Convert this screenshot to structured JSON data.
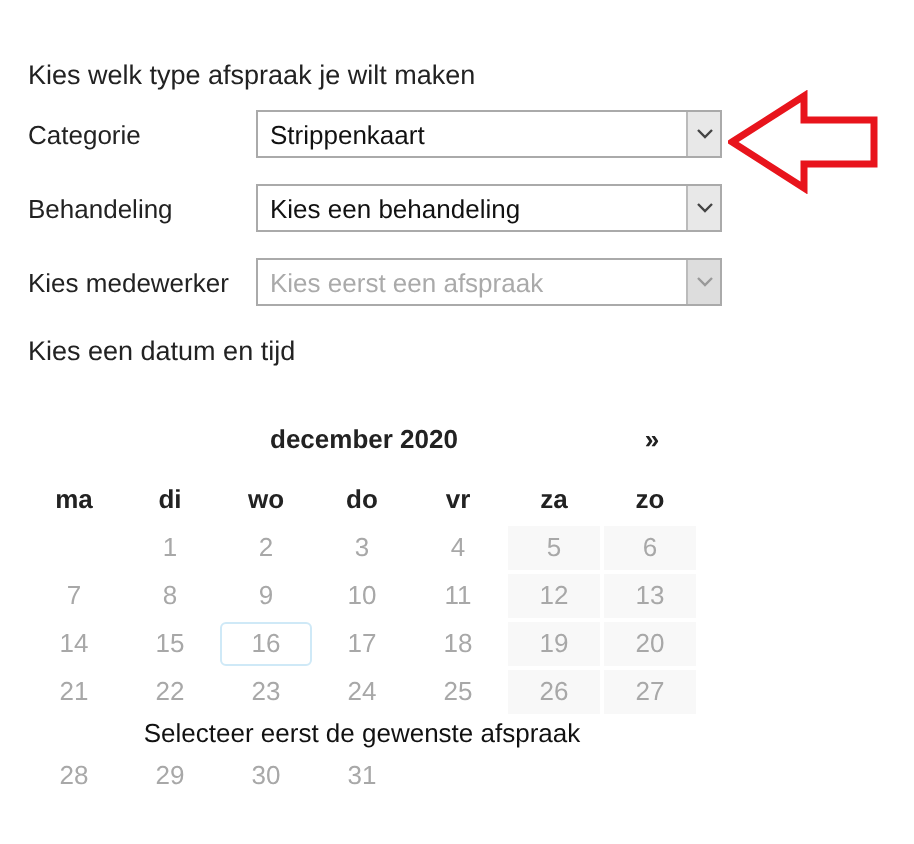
{
  "heading": "Kies welk type afspraak je wilt maken",
  "fields": [
    {
      "label": "Categorie",
      "value": "Strippenkaart",
      "disabled": false
    },
    {
      "label": "Behandeling",
      "value": "Kies een behandeling",
      "disabled": false
    },
    {
      "label": "Kies medewerker",
      "value": "Kies eerst een afspraak",
      "disabled": true
    }
  ],
  "date_heading": "Kies een datum en tijd",
  "calendar": {
    "month": "december 2020",
    "next": "»",
    "weekdays": [
      "ma",
      "di",
      "wo",
      "do",
      "vr",
      "za",
      "zo"
    ],
    "days": [
      {
        "kind": "empty"
      },
      {
        "text": "1",
        "kind": "weekday",
        "selected": false
      },
      {
        "text": "2",
        "kind": "weekday",
        "selected": false
      },
      {
        "text": "3",
        "kind": "weekday",
        "selected": false
      },
      {
        "text": "4",
        "kind": "weekday",
        "selected": false
      },
      {
        "text": "5",
        "kind": "weekend",
        "selected": false
      },
      {
        "text": "6",
        "kind": "weekend",
        "selected": false
      },
      {
        "text": "7",
        "kind": "weekday",
        "selected": false
      },
      {
        "text": "8",
        "kind": "weekday",
        "selected": false
      },
      {
        "text": "9",
        "kind": "weekday",
        "selected": false
      },
      {
        "text": "10",
        "kind": "weekday",
        "selected": false
      },
      {
        "text": "11",
        "kind": "weekday",
        "selected": false
      },
      {
        "text": "12",
        "kind": "weekend",
        "selected": false
      },
      {
        "text": "13",
        "kind": "weekend",
        "selected": false
      },
      {
        "text": "14",
        "kind": "weekday",
        "selected": false
      },
      {
        "text": "15",
        "kind": "weekday",
        "selected": false
      },
      {
        "text": "16",
        "kind": "weekday",
        "selected": true
      },
      {
        "text": "17",
        "kind": "weekday",
        "selected": false
      },
      {
        "text": "18",
        "kind": "weekday",
        "selected": false
      },
      {
        "text": "19",
        "kind": "weekend",
        "selected": false
      },
      {
        "text": "20",
        "kind": "weekend",
        "selected": false
      },
      {
        "text": "21",
        "kind": "weekday",
        "selected": false
      },
      {
        "text": "22",
        "kind": "weekday",
        "selected": false
      },
      {
        "text": "23",
        "kind": "weekday",
        "selected": false
      },
      {
        "text": "24",
        "kind": "weekday",
        "selected": false
      },
      {
        "text": "25",
        "kind": "weekday",
        "selected": false
      },
      {
        "text": "26",
        "kind": "weekend",
        "selected": false
      },
      {
        "text": "27",
        "kind": "weekend",
        "selected": false
      },
      {
        "text": "28",
        "kind": "weekday",
        "selected": false
      },
      {
        "text": "29",
        "kind": "weekday",
        "selected": false
      },
      {
        "text": "30",
        "kind": "weekday",
        "selected": false
      },
      {
        "text": "31",
        "kind": "weekday",
        "selected": false
      }
    ],
    "message": "Selecteer eerst de gewenste afspraak"
  }
}
